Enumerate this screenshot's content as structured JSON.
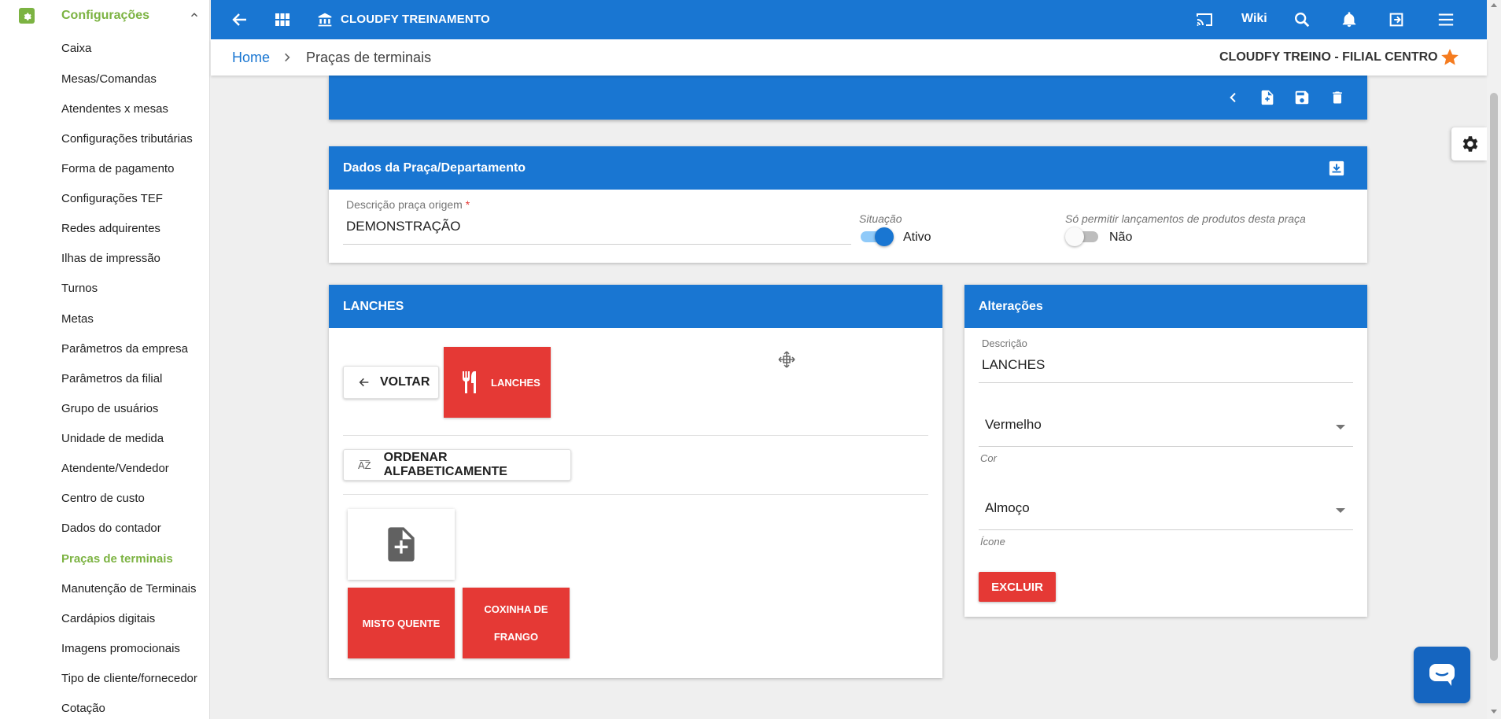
{
  "sidebar": {
    "section_label": "Configurações",
    "items": [
      {
        "label": "Caixa",
        "active": false
      },
      {
        "label": "Mesas/Comandas",
        "active": false
      },
      {
        "label": "Atendentes x mesas",
        "active": false
      },
      {
        "label": "Configurações tributárias",
        "active": false
      },
      {
        "label": "Forma de pagamento",
        "active": false
      },
      {
        "label": "Configurações TEF",
        "active": false
      },
      {
        "label": "Redes adquirentes",
        "active": false
      },
      {
        "label": "Ilhas de impressão",
        "active": false
      },
      {
        "label": "Turnos",
        "active": false
      },
      {
        "label": "Metas",
        "active": false
      },
      {
        "label": "Parâmetros da empresa",
        "active": false
      },
      {
        "label": "Parâmetros da filial",
        "active": false
      },
      {
        "label": "Grupo de usuários",
        "active": false
      },
      {
        "label": "Unidade de medida",
        "active": false
      },
      {
        "label": "Atendente/Vendedor",
        "active": false
      },
      {
        "label": "Centro de custo",
        "active": false
      },
      {
        "label": "Dados do contador",
        "active": false
      },
      {
        "label": "Praças de terminais",
        "active": true
      },
      {
        "label": "Manutenção de Terminais",
        "active": false
      },
      {
        "label": "Cardápios digitais",
        "active": false
      },
      {
        "label": "Imagens promocionais",
        "active": false
      },
      {
        "label": "Tipo de cliente/fornecedor",
        "active": false
      },
      {
        "label": "Cotação",
        "active": false
      }
    ]
  },
  "topbar": {
    "title": "CLOUDFY TREINAMENTO",
    "wiki_label": "Wiki"
  },
  "breadcrumb": {
    "home": "Home",
    "current": "Praças de terminais",
    "branch": "CLOUDFY TREINO - FILIAL CENTRO"
  },
  "dados": {
    "header": "Dados da Praça/Departamento",
    "descricao_label": "Descrição praça origem",
    "descricao_required_mark": "*",
    "descricao_value": "DEMONSTRAÇÃO",
    "situacao_label": "Situação",
    "situacao_value": "Ativo",
    "situacao_on": true,
    "permitir_label": "Só permitir lançamentos de produtos desta praça",
    "permitir_value": "Não",
    "permitir_on": false
  },
  "lanches": {
    "header": "LANCHES",
    "voltar_label": "VOLTAR",
    "current_tile": "LANCHES",
    "ordenar_label": "ORDENAR ALFABETICAMENTE",
    "ordenar_icon_text": "A͞Z",
    "products": [
      "MISTO QUENTE",
      "COXINHA DE FRANGO"
    ]
  },
  "alteracoes": {
    "header": "Alterações",
    "descricao_label": "Descrição",
    "descricao_value": "LANCHES",
    "cor_value": "Vermelho",
    "cor_label": "Cor",
    "icone_value": "Almoço",
    "icone_label": "Ícone",
    "excluir_label": "EXCLUIR"
  },
  "colors": {
    "primary": "#1976d2",
    "accent_green": "#7cb342",
    "tile_red": "#e53935",
    "star_orange": "#f57c20"
  }
}
